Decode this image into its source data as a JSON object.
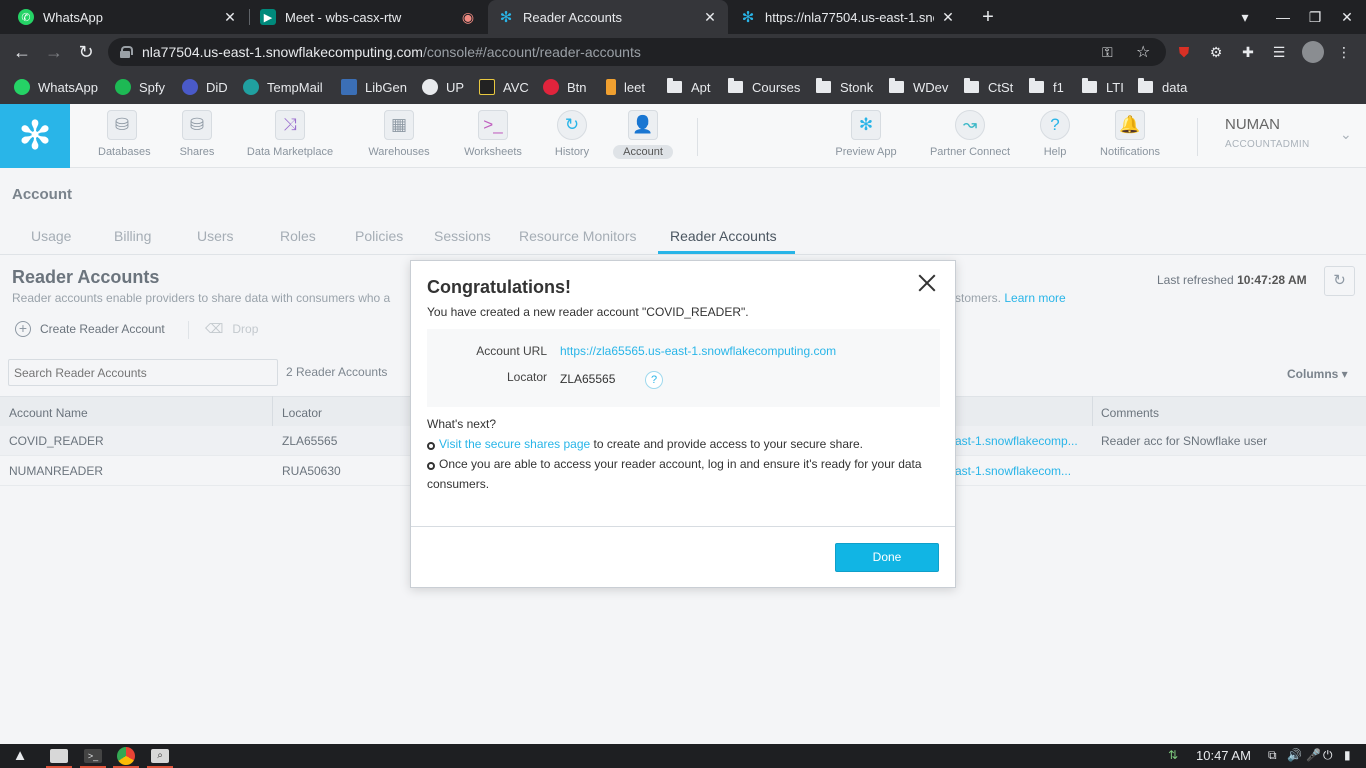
{
  "browser": {
    "tabs": [
      {
        "label": "WhatsApp",
        "active": false
      },
      {
        "label": "Meet - wbs-casx-rtw",
        "active": false
      },
      {
        "label": "Reader Accounts",
        "active": true
      },
      {
        "label": "https://nla77504.us-east-1.sno",
        "active": false
      }
    ],
    "new_tab": "+",
    "url_host": "nla77504.us-east-1.snowflakecomputing.com",
    "url_path": "/console#/account/reader-accounts",
    "bookmarks": [
      "WhatsApp",
      "Spfy",
      "DiD",
      "TempMail",
      "LibGen",
      "UP",
      "AVC",
      "Btn",
      "leet",
      "Apt",
      "Courses",
      "Stonk",
      "WDev",
      "CtSt",
      "f1",
      "LTI",
      "data"
    ]
  },
  "app": {
    "nav": [
      "Databases",
      "Shares",
      "Data Marketplace",
      "Warehouses",
      "Worksheets",
      "History",
      "Account"
    ],
    "nav_right": [
      "Preview App",
      "Partner Connect",
      "Help",
      "Notifications"
    ],
    "user_name": "NUMAN",
    "user_role": "ACCOUNTADMIN"
  },
  "page": {
    "breadcrumb": "Account",
    "subtabs": [
      "Usage",
      "Billing",
      "Users",
      "Roles",
      "Policies",
      "Sessions",
      "Resource Monitors",
      "Reader Accounts"
    ],
    "title": "Reader Accounts",
    "description_start": "Reader accounts enable providers to share data with consumers who a",
    "description_end": "stomers.",
    "learn_more": "Learn more",
    "last_refreshed_label": "Last refreshed",
    "last_refreshed_time": "10:47:28 AM",
    "create_label": "Create Reader Account",
    "drop_label": "Drop",
    "search_placeholder": "Search Reader Accounts",
    "count_label": "2 Reader Accounts",
    "columns_label": "Columns ▾",
    "table": {
      "headers": [
        "Account Name",
        "Locator",
        "",
        "Comments"
      ],
      "rows": [
        {
          "name": "COVID_READER",
          "locator": "ZLA65565",
          "url": "ast-1.snowflakecomp...",
          "comment": "Reader acc for SNowflake user"
        },
        {
          "name": "NUMANREADER",
          "locator": "RUA50630",
          "url": "ast-1.snowflakecom...",
          "comment": ""
        }
      ]
    }
  },
  "modal": {
    "title": "Congratulations!",
    "message": "You have created a new reader account \"COVID_READER\".",
    "account_url_label": "Account URL",
    "account_url": "https://zla65565.us-east-1.snowflakecomputing.com",
    "locator_label": "Locator",
    "locator": "ZLA65565",
    "help": "?",
    "whats_next": "What's next?",
    "step1_link": "Visit the secure shares page",
    "step1_text": " to create and provide access to your secure share.",
    "step2_line1": "Once you are able to access your reader account, log in and ensure it's ready for your data",
    "step2_line2": "consumers.",
    "done_label": "Done"
  },
  "taskbar": {
    "time": "10:47 AM"
  },
  "colors": {
    "snowflake_blue": "#29b5e8",
    "done_button": "#11b5e4"
  }
}
